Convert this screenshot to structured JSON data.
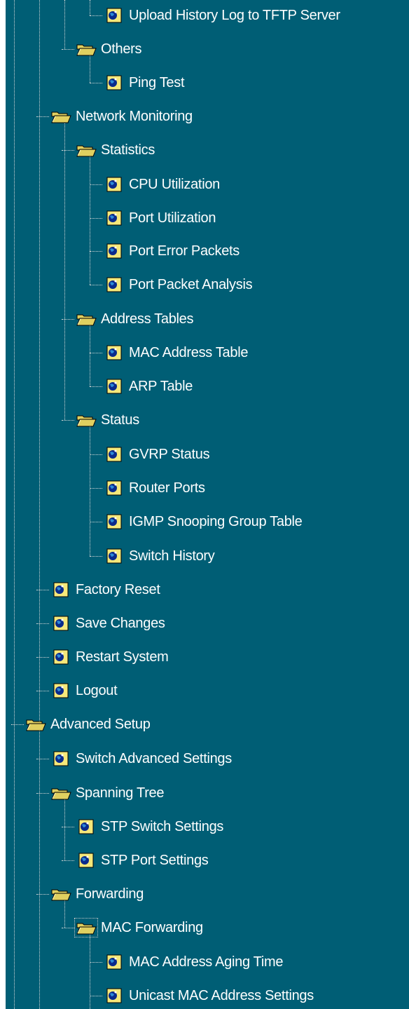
{
  "tree": {
    "nodes": [
      {
        "id": "upload-history-log",
        "label": "Upload History Log to TFTP Server",
        "type": "page"
      },
      {
        "id": "others",
        "label": "Others",
        "type": "folder"
      },
      {
        "id": "ping-test",
        "label": "Ping Test",
        "type": "page"
      },
      {
        "id": "network-monitoring",
        "label": "Network Monitoring",
        "type": "folder"
      },
      {
        "id": "statistics",
        "label": "Statistics",
        "type": "folder"
      },
      {
        "id": "cpu-utilization",
        "label": "CPU Utilization",
        "type": "page"
      },
      {
        "id": "port-utilization",
        "label": "Port Utilization",
        "type": "page"
      },
      {
        "id": "port-error-packets",
        "label": "Port Error Packets",
        "type": "page"
      },
      {
        "id": "port-packet-analysis",
        "label": "Port Packet Analysis",
        "type": "page"
      },
      {
        "id": "address-tables",
        "label": "Address Tables",
        "type": "folder"
      },
      {
        "id": "mac-address-table",
        "label": "MAC Address Table",
        "type": "page"
      },
      {
        "id": "arp-table",
        "label": "ARP Table",
        "type": "page"
      },
      {
        "id": "status",
        "label": "Status",
        "type": "folder"
      },
      {
        "id": "gvrp-status",
        "label": "GVRP Status",
        "type": "page"
      },
      {
        "id": "router-ports",
        "label": "Router Ports",
        "type": "page"
      },
      {
        "id": "igmp-snooping-group-table",
        "label": "IGMP Snooping Group Table",
        "type": "page"
      },
      {
        "id": "switch-history",
        "label": "Switch History",
        "type": "page"
      },
      {
        "id": "factory-reset",
        "label": "Factory Reset",
        "type": "page"
      },
      {
        "id": "save-changes",
        "label": "Save Changes",
        "type": "page"
      },
      {
        "id": "restart-system",
        "label": "Restart System",
        "type": "page"
      },
      {
        "id": "logout",
        "label": "Logout",
        "type": "page"
      },
      {
        "id": "advanced-setup",
        "label": "Advanced Setup",
        "type": "folder"
      },
      {
        "id": "switch-advanced-settings",
        "label": "Switch Advanced Settings",
        "type": "page"
      },
      {
        "id": "spanning-tree",
        "label": "Spanning Tree",
        "type": "folder"
      },
      {
        "id": "stp-switch-settings",
        "label": "STP Switch Settings",
        "type": "page"
      },
      {
        "id": "stp-port-settings",
        "label": "STP Port Settings",
        "type": "page"
      },
      {
        "id": "forwarding",
        "label": "Forwarding",
        "type": "folder"
      },
      {
        "id": "mac-forwarding",
        "label": "MAC Forwarding",
        "type": "folder",
        "focused": true
      },
      {
        "id": "mac-address-aging-time",
        "label": "MAC Address Aging Time",
        "type": "page"
      },
      {
        "id": "unicast-mac-address-settings",
        "label": "Unicast MAC Address Settings",
        "type": "page"
      }
    ]
  },
  "colors": {
    "background": "#005e75",
    "text": "#ffffff",
    "connector": "#d8d8d8",
    "folder": "#e0d060",
    "page_icon_bg": "#f5e87a",
    "page_icon_globe": "#0a2a8c"
  },
  "icons": {
    "folder": "open-folder-icon",
    "page": "globe-page-icon"
  }
}
